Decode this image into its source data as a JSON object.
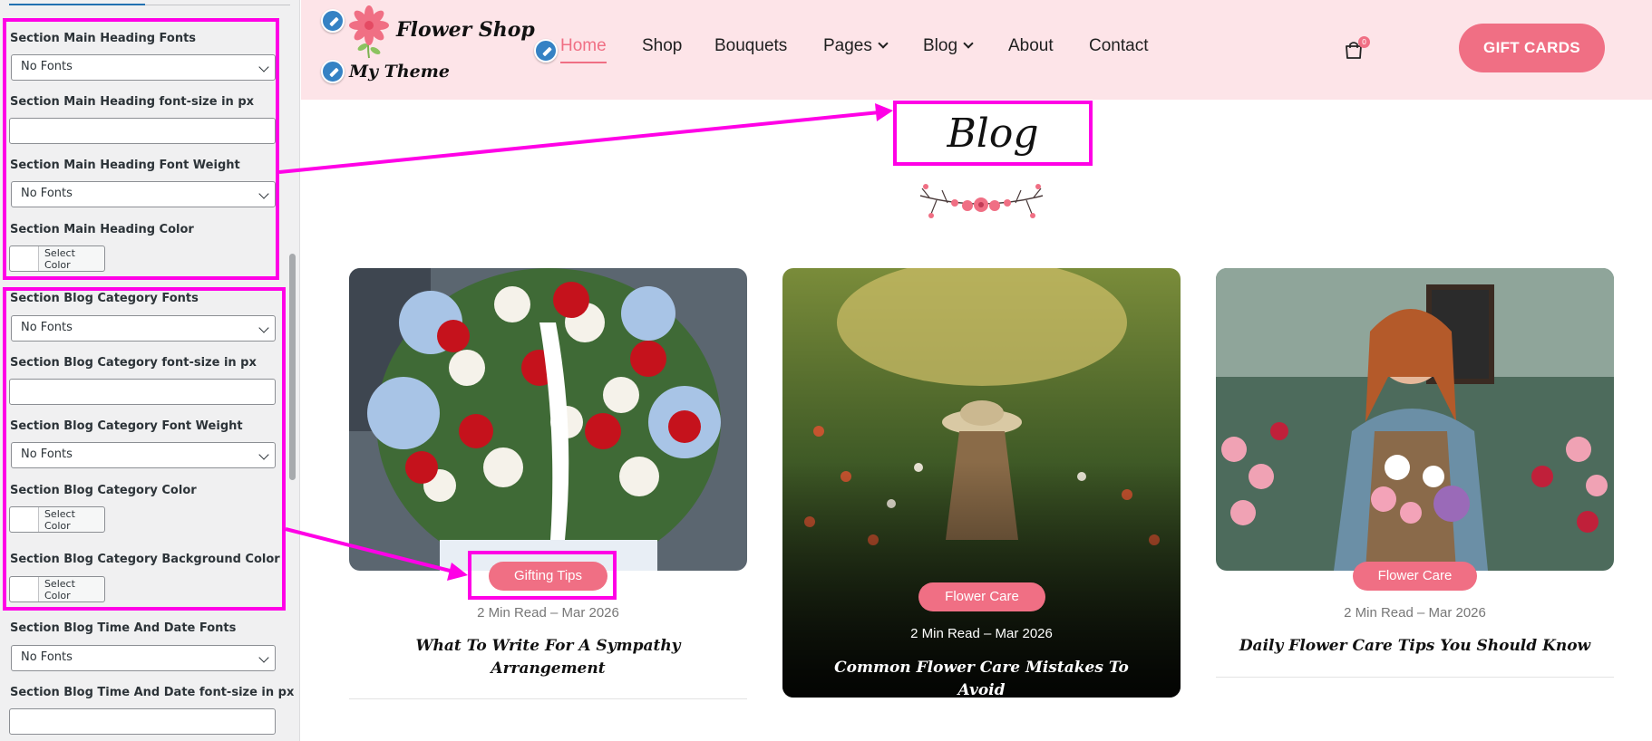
{
  "panel": {
    "controls": [
      {
        "label": "Section Main Heading Fonts",
        "value": "No Fonts"
      },
      {
        "label": "Section Main Heading font-size in px",
        "value": ""
      },
      {
        "label": "Section Main Heading Font Weight",
        "value": "No Fonts"
      },
      {
        "label": "Section Main Heading Color",
        "button": "Select Color"
      },
      {
        "label": "Section Blog Category Fonts",
        "value": "No Fonts"
      },
      {
        "label": "Section Blog Category font-size in px",
        "value": ""
      },
      {
        "label": "Section Blog Category Font Weight",
        "value": "No Fonts"
      },
      {
        "label": "Section Blog Category Color",
        "button": "Select Color"
      },
      {
        "label": "Section Blog Category Background Color",
        "button": "Select Color"
      },
      {
        "label": "Section Blog Time And Date Fonts",
        "value": "No Fonts"
      },
      {
        "label": "Section Blog Time And Date font-size in px",
        "value": ""
      }
    ]
  },
  "header": {
    "logo_text": "Flower Shop",
    "theme_text": "My Theme",
    "nav": [
      "Home",
      "Shop",
      "Bouquets",
      "Pages",
      "Blog",
      "About",
      "Contact"
    ],
    "cart_count": "0",
    "cta": "GIFT CARDS"
  },
  "main": {
    "section_title": "Blog",
    "posts": [
      {
        "category": "Gifting Tips",
        "meta": "2 Min Read – Mar 2026",
        "title": "What To Write For A Sympathy Arrangement"
      },
      {
        "category": "Flower Care",
        "meta": "2 Min Read – Mar 2026",
        "title": "Common Flower Care Mistakes To Avoid"
      },
      {
        "category": "Flower Care",
        "meta": "2 Min Read – Mar 2026",
        "title": "Daily Flower Care Tips You Should Know"
      }
    ]
  },
  "colors": {
    "accent": "#f06f84",
    "header_bg": "#fde4e8",
    "highlight": "#ff00e6",
    "panel_bg": "#f0f0f1"
  }
}
